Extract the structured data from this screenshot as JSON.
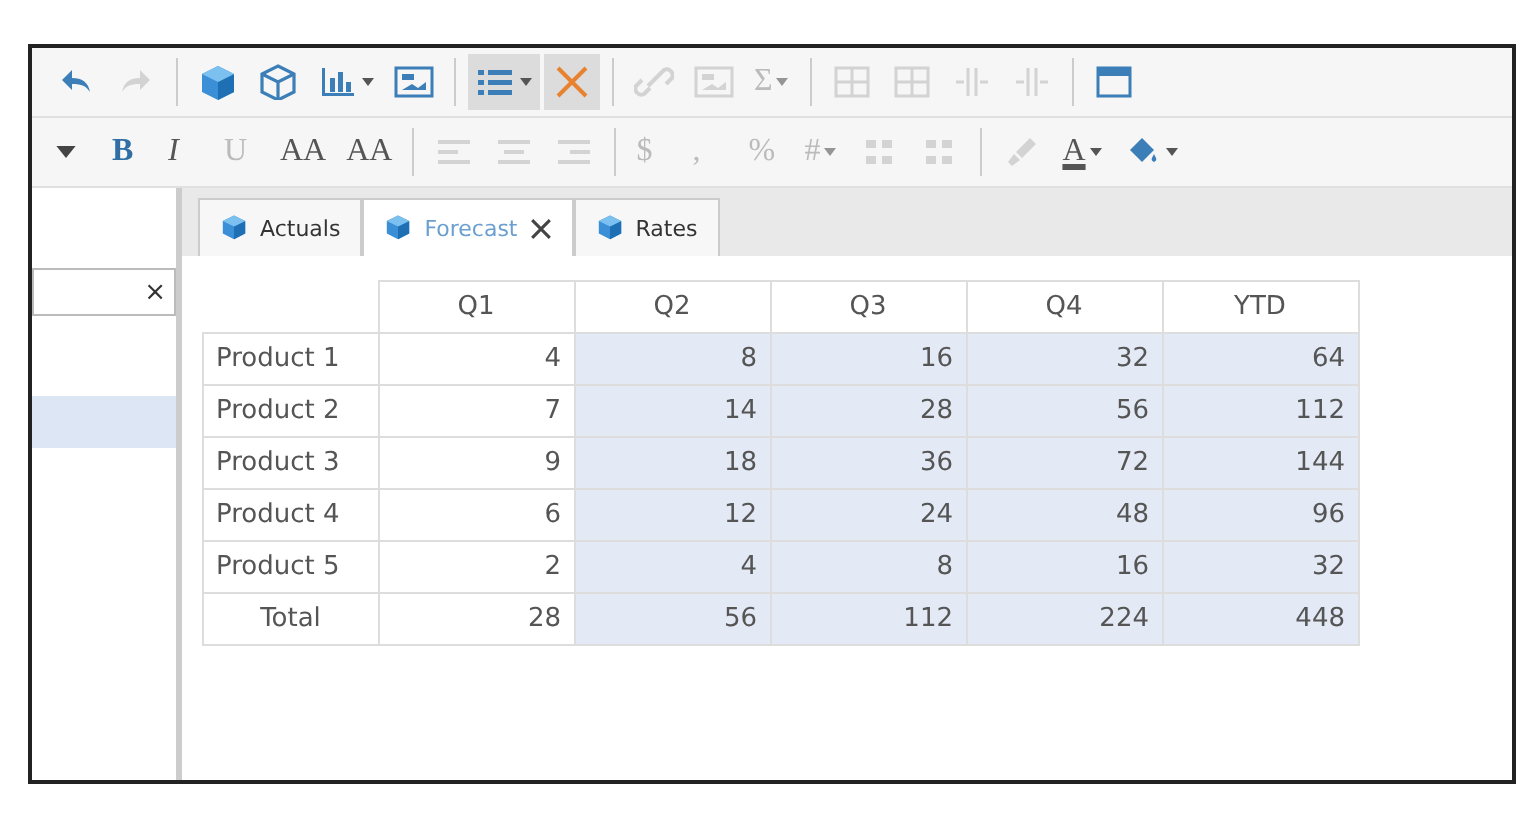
{
  "toolbar_top": [
    {
      "kind": "icon",
      "disabled": false,
      "selected": false,
      "dropdown": false
    },
    {
      "kind": "icon",
      "disabled": true,
      "selected": false,
      "dropdown": false
    },
    {
      "kind": "separator"
    },
    {
      "kind": "icon",
      "disabled": false,
      "selected": false,
      "dropdown": false
    },
    {
      "kind": "icon",
      "disabled": false,
      "selected": false,
      "dropdown": false
    },
    {
      "kind": "icon",
      "disabled": false,
      "selected": false,
      "dropdown": true
    },
    {
      "kind": "icon",
      "disabled": false,
      "selected": false,
      "dropdown": false
    },
    {
      "kind": "separator"
    },
    {
      "kind": "icon",
      "disabled": false,
      "selected": true,
      "dropdown": true
    },
    {
      "kind": "icon",
      "disabled": false,
      "selected": true,
      "dropdown": false
    },
    {
      "kind": "separator"
    },
    {
      "kind": "icon",
      "disabled": true,
      "selected": false,
      "dropdown": false
    },
    {
      "kind": "icon",
      "disabled": true,
      "selected": false,
      "dropdown": false
    },
    {
      "kind": "text",
      "text": "Σ",
      "disabled": true,
      "selected": false,
      "dropdown": true
    },
    {
      "kind": "separator"
    },
    {
      "kind": "icon",
      "disabled": true,
      "selected": false,
      "dropdown": false
    },
    {
      "kind": "icon",
      "disabled": true,
      "selected": false,
      "dropdown": false
    },
    {
      "kind": "icon",
      "disabled": true,
      "selected": false,
      "dropdown": false
    },
    {
      "kind": "icon",
      "disabled": true,
      "selected": false,
      "dropdown": false
    },
    {
      "kind": "separator"
    },
    {
      "kind": "icon",
      "disabled": false,
      "selected": false,
      "dropdown": false
    }
  ],
  "toolbar_format": [
    {
      "kind": "icon",
      "disabled": false,
      "selected": false,
      "dropdown": false
    },
    {
      "kind": "text",
      "text": "B",
      "disabled": false,
      "selected": false,
      "dropdown": false
    },
    {
      "kind": "text",
      "text": "I",
      "disabled": false,
      "selected": false,
      "dropdown": false
    },
    {
      "kind": "text",
      "text": "U",
      "disabled": true,
      "selected": false,
      "dropdown": false
    },
    {
      "kind": "text",
      "text": "AA",
      "disabled": false,
      "selected": false,
      "dropdown": false
    },
    {
      "kind": "text",
      "text": "AA",
      "disabled": false,
      "selected": false,
      "dropdown": false
    },
    {
      "kind": "separator"
    },
    {
      "kind": "icon",
      "disabled": true,
      "selected": false,
      "dropdown": false
    },
    {
      "kind": "icon",
      "disabled": true,
      "selected": false,
      "dropdown": false
    },
    {
      "kind": "icon",
      "disabled": true,
      "selected": false,
      "dropdown": false
    },
    {
      "kind": "separator"
    },
    {
      "kind": "text",
      "text": "$",
      "disabled": true,
      "selected": false,
      "dropdown": false
    },
    {
      "kind": "text",
      "text": ",",
      "disabled": true,
      "selected": false,
      "dropdown": false
    },
    {
      "kind": "text",
      "text": "%",
      "disabled": true,
      "selected": false,
      "dropdown": false
    },
    {
      "kind": "text",
      "text": "#",
      "disabled": true,
      "selected": false,
      "dropdown": true
    },
    {
      "kind": "icon",
      "disabled": true,
      "selected": false,
      "dropdown": false
    },
    {
      "kind": "icon",
      "disabled": true,
      "selected": false,
      "dropdown": false
    },
    {
      "kind": "separator"
    },
    {
      "kind": "icon",
      "disabled": true,
      "selected": false,
      "dropdown": false
    },
    {
      "kind": "text",
      "text": "A",
      "disabled": false,
      "selected": false,
      "dropdown": true
    },
    {
      "kind": "icon",
      "disabled": false,
      "selected": false,
      "dropdown": true
    }
  ],
  "tabs": [
    {
      "label": "Actuals",
      "selected": false,
      "closable": false
    },
    {
      "label": "Forecast",
      "selected": true,
      "closable": true
    },
    {
      "label": "Rates",
      "selected": false,
      "closable": false
    }
  ],
  "sidebar": {
    "search": {
      "clear": "×"
    },
    "items": [
      {
        "selected": true
      }
    ]
  },
  "table": {
    "columns": [
      {
        "label": "Q1",
        "highlighted": false
      },
      {
        "label": "Q2",
        "highlighted": true
      },
      {
        "label": "Q3",
        "highlighted": true
      },
      {
        "label": "Q4",
        "highlighted": true
      },
      {
        "label": "YTD",
        "highlighted": true
      }
    ],
    "rows": [
      {
        "label": "Product 1",
        "cells": [
          "4",
          "8",
          "16",
          "32",
          "64"
        ]
      },
      {
        "label": "Product 2",
        "cells": [
          "7",
          "14",
          "28",
          "56",
          "112"
        ]
      },
      {
        "label": "Product 3",
        "cells": [
          "9",
          "18",
          "36",
          "72",
          "144"
        ]
      },
      {
        "label": "Product 4",
        "cells": [
          "6",
          "12",
          "24",
          "48",
          "96"
        ]
      },
      {
        "label": "Product 5",
        "cells": [
          "2",
          "4",
          "8",
          "16",
          "32"
        ]
      },
      {
        "label": "Total",
        "cells": [
          "28",
          "56",
          "112",
          "224",
          "448"
        ]
      }
    ]
  }
}
